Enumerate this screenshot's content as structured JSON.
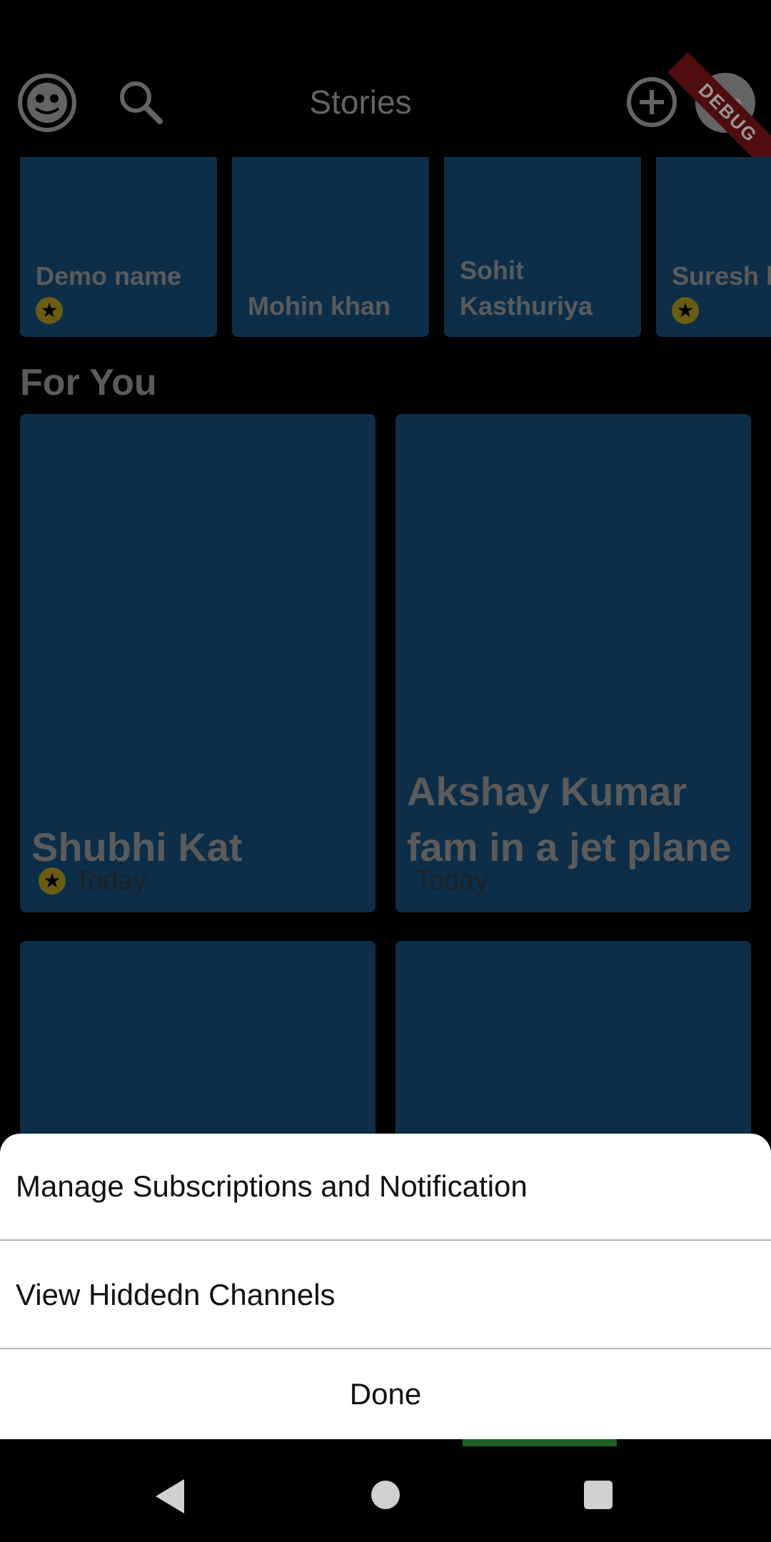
{
  "header": {
    "title": "Stories",
    "debug_banner": "DEBUG",
    "icons": [
      "face-icon",
      "search-icon",
      "add-circle-icon",
      "more-icon"
    ]
  },
  "stories": [
    {
      "name": "Demo name",
      "starred": true
    },
    {
      "name": "Mohin khan",
      "starred": false
    },
    {
      "name": "Sohit Kasthuriya",
      "starred": false
    },
    {
      "name": "Suresh k",
      "starred": true
    }
  ],
  "section": {
    "title": "For You"
  },
  "cards": [
    {
      "title": "Shubhi Kat",
      "date": "Today",
      "starred": true
    },
    {
      "title": "Akshay Kumar fam in a jet plane",
      "date": "Today",
      "starred": false
    }
  ],
  "sheet": {
    "items": [
      "Manage Subscriptions and Notification",
      "View Hiddedn Channels"
    ],
    "done_label": "Done"
  },
  "colors": {
    "card": "#134770",
    "star_badge": "#a48f1e",
    "debug_ribbon": "#7a1515"
  }
}
